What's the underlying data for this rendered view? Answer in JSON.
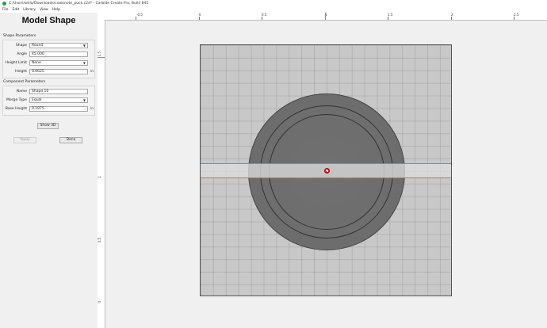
{
  "window": {
    "title": "C:/Users/willa/Downloads/cookinote_puck.c2d* - Carbide Create Pro, Build 845"
  },
  "menu": [
    "File",
    "Edit",
    "Library",
    "View",
    "Help"
  ],
  "panel": {
    "title": "Model Shape",
    "shape_params": {
      "section_label": "Shape Parameters",
      "shape_label": "Shape",
      "shape_value": "Round",
      "angle_label": "Angle",
      "angle_value": "45.000",
      "height_limit_label": "Height Limit",
      "height_limit_value": "None",
      "height_label": "Height",
      "height_value": "0.0625",
      "height_unit": "in"
    },
    "component_params": {
      "section_label": "Component Parameters",
      "name_label": "Name",
      "name_value": "Shape 10",
      "merge_type_label": "Merge Type",
      "merge_type_value": "Equal",
      "base_height_label": "Base Height",
      "base_height_value": "0.1875",
      "base_height_unit": "in"
    },
    "show3d_label": "Show 3D",
    "apply_label": "Apply",
    "done_label": "Done"
  },
  "ruler": {
    "top_labels": [
      "-0.5",
      "0",
      "0.5",
      "1",
      "1.5",
      "2",
      "2.5"
    ],
    "left_labels": [
      "1.5",
      "1",
      "0.5",
      "0"
    ]
  },
  "icons": {
    "app": "carbide-create-icon",
    "dropdown": "chevron-down-icon",
    "origin": "origin-marker-icon"
  },
  "colors": {
    "selection": "#e0702c",
    "origin": "#e02020"
  }
}
